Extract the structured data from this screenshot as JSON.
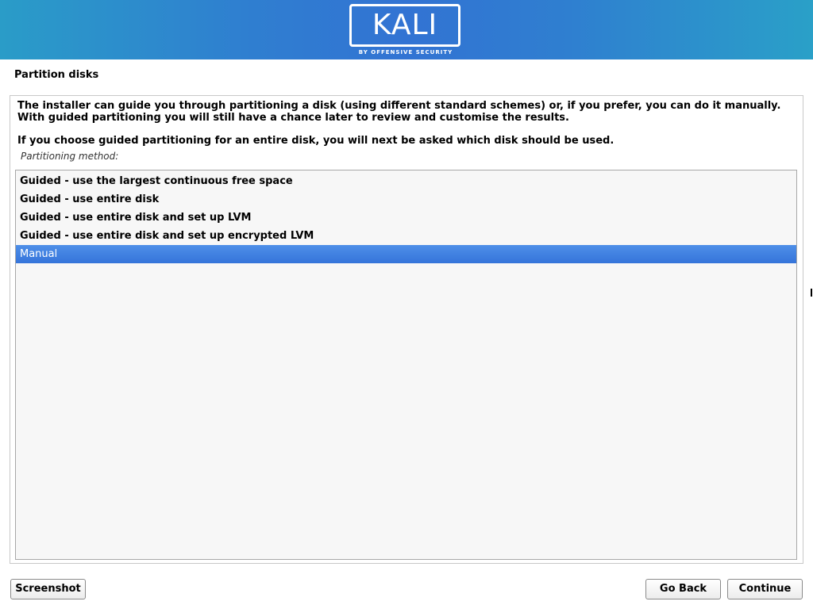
{
  "banner": {
    "logo_text": "KALI",
    "logo_subtitle": "BY OFFENSIVE SECURITY",
    "colors": {
      "gradient_start": "#2a9cc8",
      "gradient_mid": "#3273d3"
    }
  },
  "page": {
    "title": "Partition disks"
  },
  "content": {
    "paragraph1": "The installer can guide you through partitioning a disk (using different standard schemes) or, if you prefer, you can do it manually. With guided partitioning you will still have a chance later to review and customise the results.",
    "paragraph2": "If you choose guided partitioning for an entire disk, you will next be asked which disk should be used.",
    "method_label": "Partitioning method:"
  },
  "options": [
    {
      "label": "Guided - use the largest continuous free space",
      "selected": false
    },
    {
      "label": "Guided - use entire disk",
      "selected": false
    },
    {
      "label": "Guided - use entire disk and set up LVM",
      "selected": false
    },
    {
      "label": "Guided - use entire disk and set up encrypted LVM",
      "selected": false
    },
    {
      "label": "Manual",
      "selected": true
    }
  ],
  "buttons": {
    "screenshot": "Screenshot",
    "go_back": "Go Back",
    "continue": "Continue"
  },
  "colors": {
    "selection": "#3a7bdf",
    "list_background": "#f7f7f7"
  }
}
